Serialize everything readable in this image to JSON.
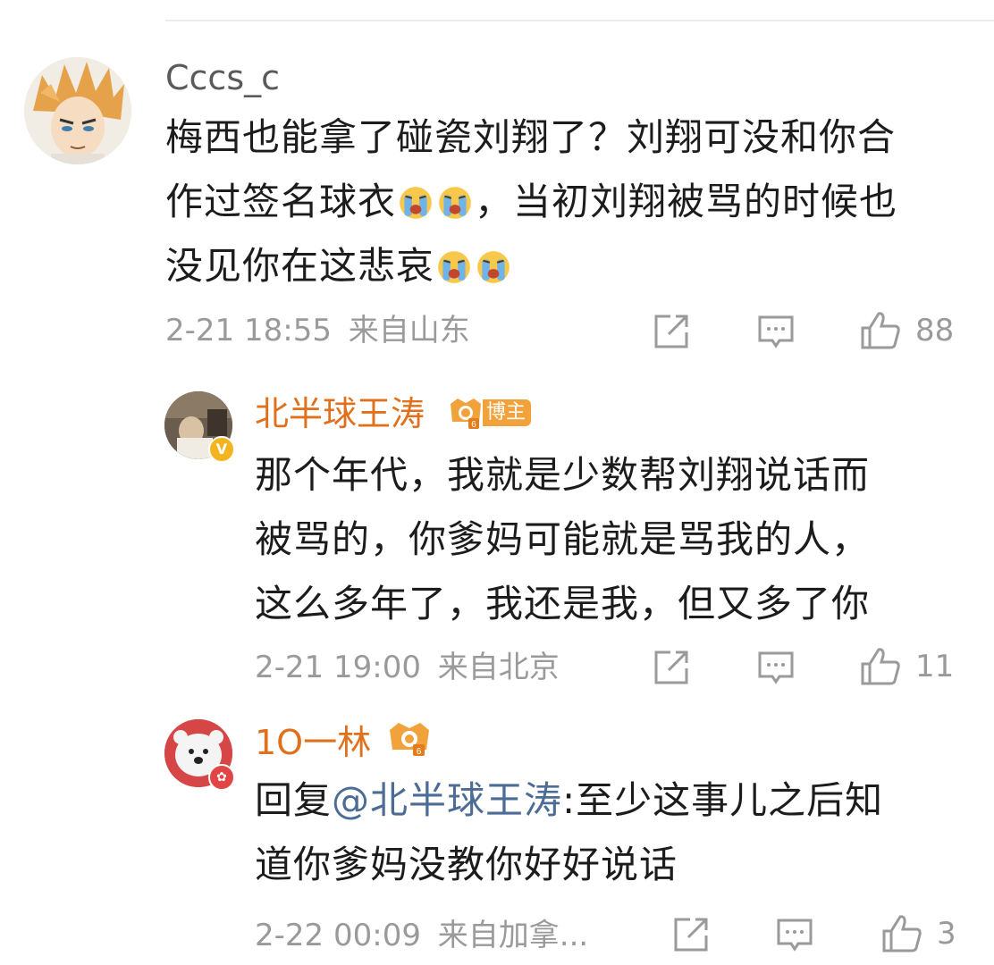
{
  "comments": [
    {
      "username": "Cccs_c",
      "content_parts": [
        "梅西也能拿了碰瓷刘翔了？刘翔可没和你合",
        "作过签名球衣",
        "，当初刘翔被骂的时候也",
        "没见你在这悲哀"
      ],
      "emoji": [
        "crying-emoji",
        "crying-emoji"
      ],
      "time": "2-21 18:55",
      "location": "来自山东",
      "likes": "88"
    },
    {
      "username": "北半球王涛",
      "username_color": "#e0701c",
      "badge_label": "博主",
      "content_lines": [
        "那个年代，我就是少数帮刘翔说话而",
        "被骂的，你爹妈可能就是骂我的人，",
        "这么多年了，我还是我，但又多了你"
      ],
      "time": "2-21 19:00",
      "location": "来自北京",
      "likes": "11"
    },
    {
      "username": "1O一林",
      "username_color": "#e0701c",
      "reply_prefix": "回复",
      "mention": "@北半球王涛",
      "content_lines": [
        ":至少这事儿之后知",
        "道你爹妈没教你好好说话"
      ],
      "time": "2-22 00:09",
      "location": "来自加拿...",
      "likes": "3"
    }
  ],
  "icons": {
    "share": "share-icon",
    "comment": "comment-icon",
    "like": "thumbs-up-icon"
  },
  "colors": {
    "meta_gray": "#9a9a9a",
    "mention_blue": "#4c6c96",
    "username_orange": "#e0701c",
    "badge_orange": "#f2a23a"
  }
}
